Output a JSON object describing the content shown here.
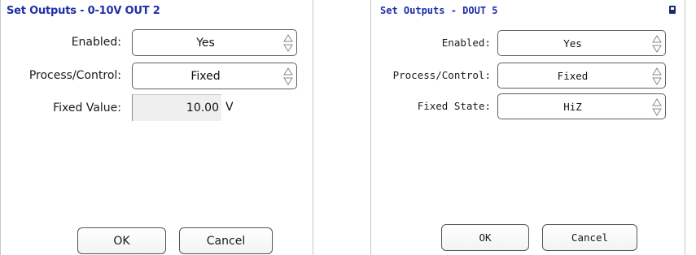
{
  "left_panel": {
    "title": "Set Outputs - 0-10V OUT 2",
    "enabled_label": "Enabled:",
    "enabled_value": "Yes",
    "process_label": "Process/Control:",
    "process_value": "Fixed",
    "fixed_value_label": "Fixed Value:",
    "fixed_value": "10.00",
    "fixed_value_unit": "V",
    "ok_label": "OK",
    "cancel_label": "Cancel"
  },
  "right_panel": {
    "title": "Set Outputs - DOUT 5",
    "enabled_label": "Enabled:",
    "enabled_value": "Yes",
    "process_label": "Process/Control:",
    "process_value": "Fixed",
    "fixed_state_label": "Fixed State:",
    "fixed_state_value": "HiZ",
    "ok_label": "OK",
    "cancel_label": "Cancel",
    "status_icon": "battery-icon"
  },
  "colors": {
    "title": "#1f2fa8",
    "border": "#5f5f5f",
    "field_bg": "#efefef",
    "status_icon": "#1c2b6e"
  }
}
